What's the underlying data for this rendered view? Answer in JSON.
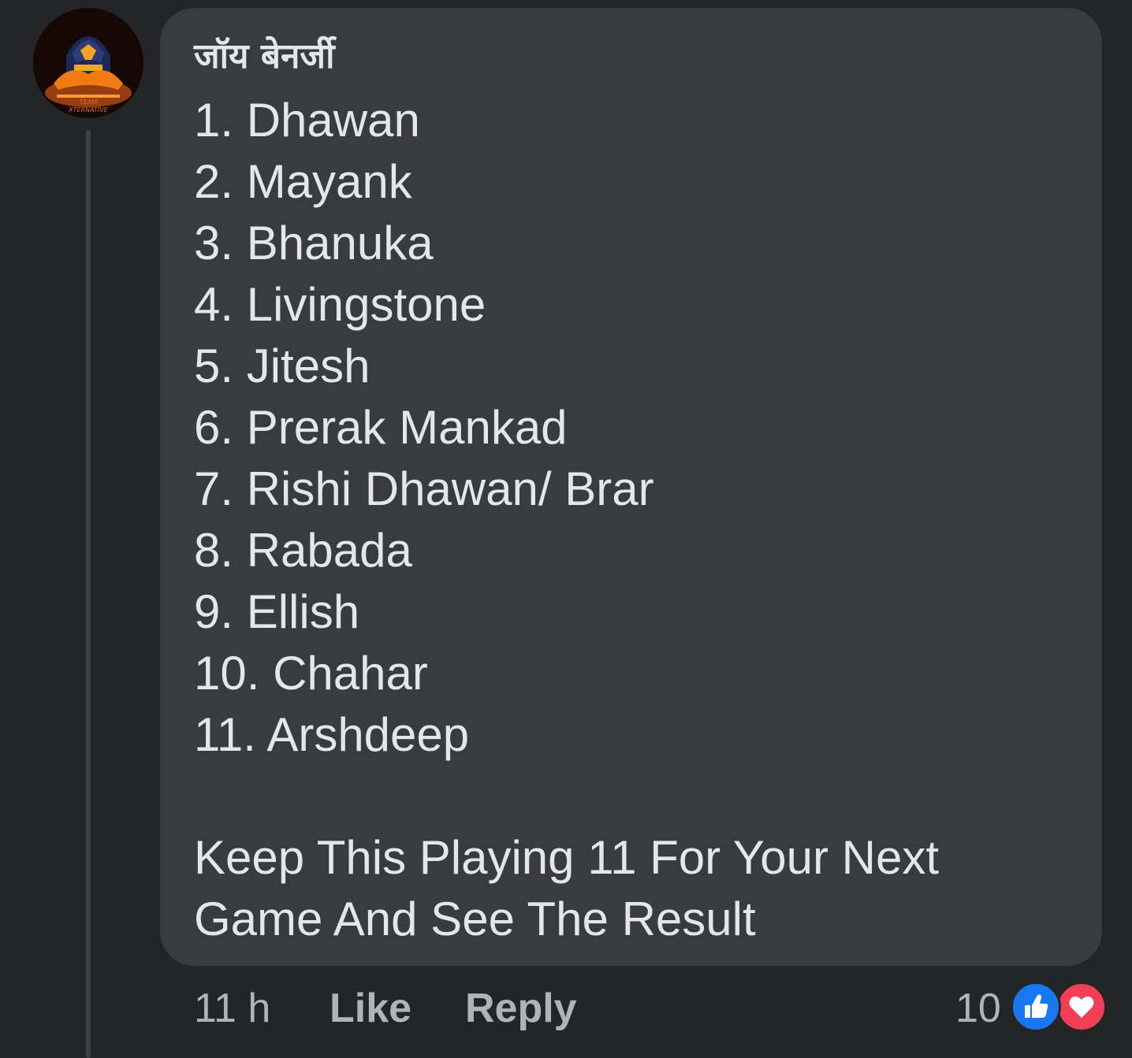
{
  "comment": {
    "author": "जॉय बेनर्जी",
    "lines": [
      "1. Dhawan",
      "2. Mayank",
      "3. Bhanuka",
      "4. Livingstone",
      "5. Jitesh",
      "6. Prerak Mankad",
      "7. Rishi Dhawan/ Brar",
      "8. Rabada",
      "9. Ellish",
      "10. Chahar",
      "11. Arshdeep"
    ],
    "closing_lines": [
      "Keep This Playing 11 For Your Next",
      "Game And See The Result"
    ]
  },
  "actions": {
    "time": "11 h",
    "like_label": "Like",
    "reply_label": "Reply"
  },
  "reactions": {
    "count": "10",
    "types": [
      "like-icon",
      "love-icon"
    ],
    "colors": {
      "like": "#1877f2",
      "love": "#f33e58"
    }
  },
  "avatar": {
    "logo_text": [
      "TEAM",
      "XTERNATIVE"
    ]
  }
}
